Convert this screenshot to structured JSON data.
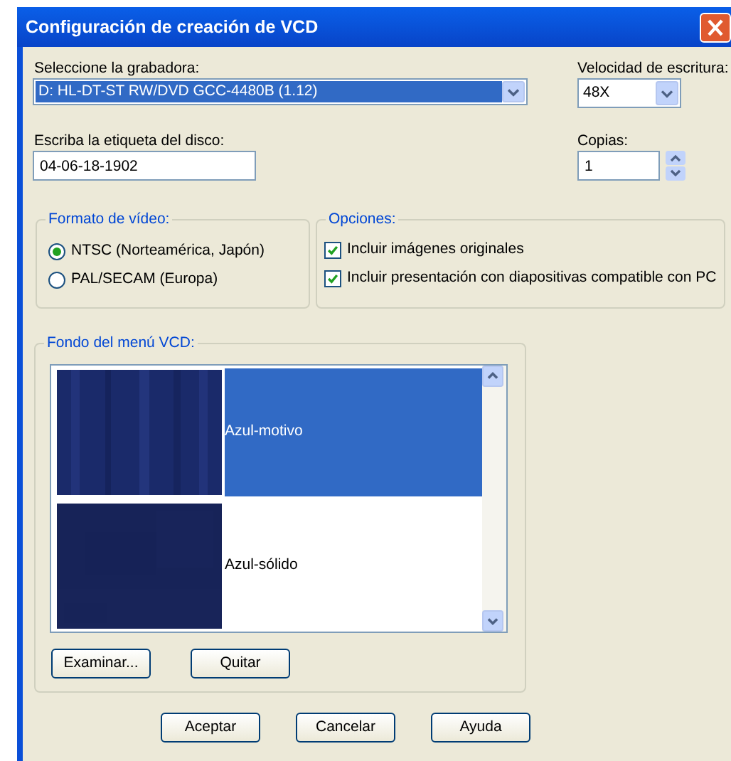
{
  "window": {
    "title": "Configuración de creación de VCD"
  },
  "recorder": {
    "label": "Seleccione la grabadora:",
    "value": "D: HL-DT-ST RW/DVD GCC-4480B (1.12)"
  },
  "speed": {
    "label": "Velocidad de escritura:",
    "value": "48X"
  },
  "disc_label": {
    "label": "Escriba la etiqueta del disco:",
    "value": "04-06-18-1902"
  },
  "copies": {
    "label": "Copias:",
    "value": "1"
  },
  "video_format": {
    "title": "Formato de vídeo:",
    "options": [
      {
        "label": "NTSC (Norteamérica, Japón)",
        "selected": true
      },
      {
        "label": "PAL/SECAM (Europa)",
        "selected": false
      }
    ]
  },
  "options": {
    "title": "Opciones:",
    "items": [
      {
        "label": "Incluir imágenes originales",
        "checked": true
      },
      {
        "label": "Incluir presentación con diapositivas compatible con PC",
        "checked": true
      }
    ]
  },
  "menu_background": {
    "title": "Fondo del menú VCD:",
    "items": [
      {
        "label": "Azul-motivo",
        "selected": true,
        "kind": "picture"
      },
      {
        "label": "Azul-sólido",
        "selected": false,
        "kind": "picture"
      }
    ],
    "buttons": [
      "Examinar...",
      "Quitar"
    ]
  },
  "buttons": [
    "Aceptar",
    "Cancelar",
    "Ayuda"
  ]
}
